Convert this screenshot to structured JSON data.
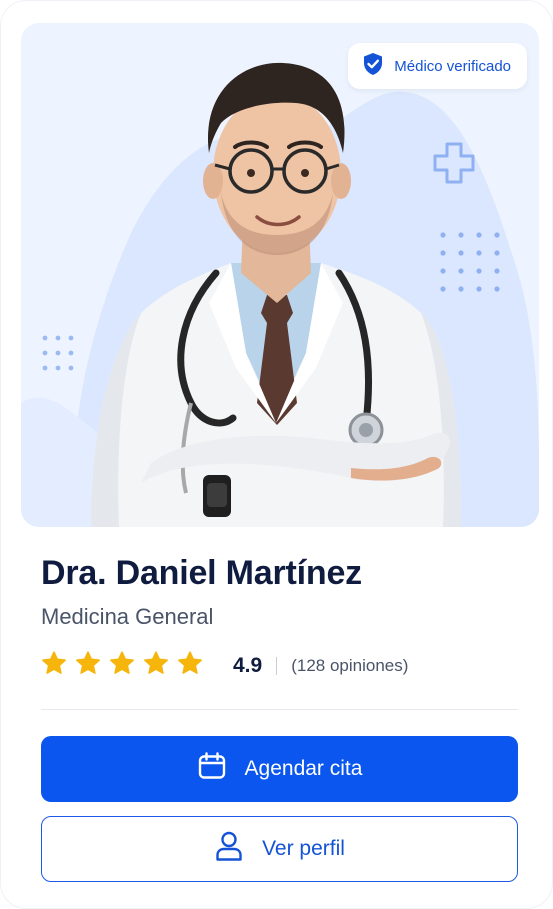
{
  "badge": {
    "label": "Médico verificado",
    "icon": "shield-check-icon"
  },
  "doctor": {
    "name": "Dra. Daniel Martínez",
    "specialty": "Medicina General"
  },
  "rating": {
    "value": "4.9",
    "stars": 5,
    "count_text": "(128 opiniones)"
  },
  "actions": {
    "primary": {
      "label": "Agendar cita",
      "icon": "calendar-icon"
    },
    "secondary": {
      "label": "Ver perfil",
      "icon": "user-icon"
    }
  },
  "colors": {
    "primary": "#0a56ee",
    "star": "#f5b50a",
    "heading": "#0f1c3f"
  }
}
